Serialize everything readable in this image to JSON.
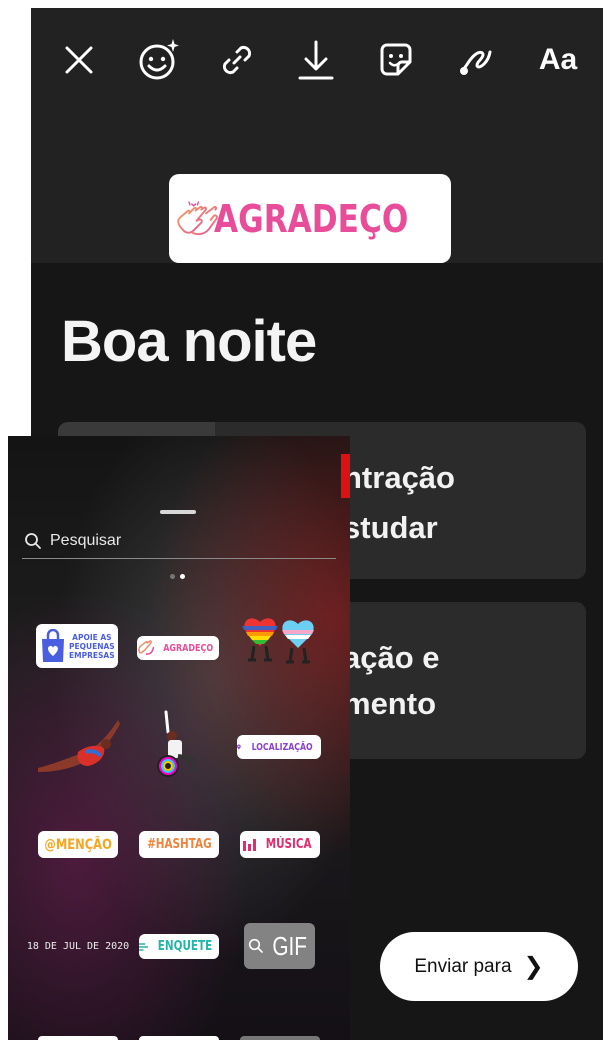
{
  "toolbar": {
    "icons": [
      "close-icon",
      "face-effects-icon",
      "link-icon",
      "download-icon",
      "sticker-icon",
      "draw-icon",
      "text-icon"
    ],
    "text_button": "Aa"
  },
  "story": {
    "sticker_label": "AGRADEÇO",
    "headline": "Boa noite",
    "cards": [
      {
        "line1": "ntração",
        "line2": "studar"
      },
      {
        "line1": "ação e",
        "line2": "mento"
      }
    ],
    "send_button": "Enviar para"
  },
  "tray": {
    "search_placeholder": "Pesquisar",
    "page_dots": {
      "count": 2,
      "active": 1
    },
    "stickers": {
      "support_small_business": [
        "APOIE AS",
        "PEQUENAS",
        "EMPRESAS"
      ],
      "thanks": "AGRADEÇO",
      "location": "LOCALIZAÇÃO",
      "mention": "@MENÇÃO",
      "hashtag": "#HASHTAG",
      "music": "MÚSICA",
      "date": "18 DE JUL DE 2020",
      "poll": "ENQUETE",
      "gif": "GIF"
    }
  },
  "colors": {
    "pink": "#e94c99",
    "purple": "#8b3fd0",
    "orange": "#f5a623",
    "teal": "#23b5a7",
    "red_strip": "#dd1111"
  }
}
